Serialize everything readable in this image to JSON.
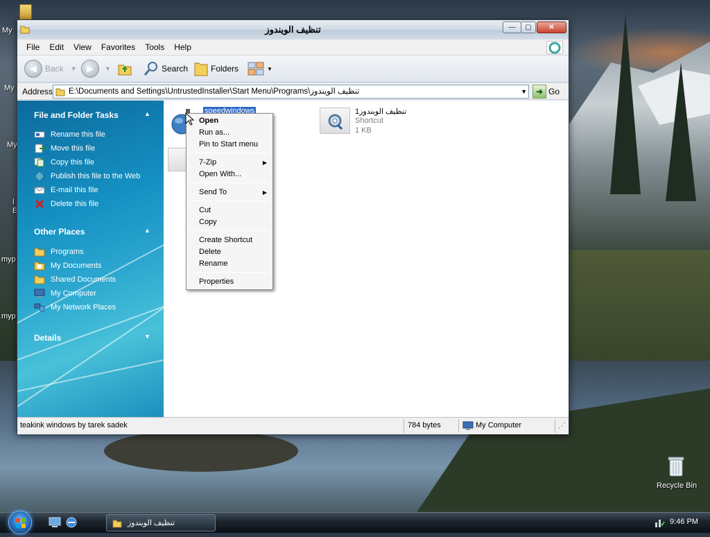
{
  "desktop": {
    "partial_labels": [
      "My",
      "My",
      "My",
      "I",
      "E",
      "myp",
      "myp"
    ],
    "recycle_bin_label": "Recycle Bin"
  },
  "window": {
    "title": "تنظيف الويندوز",
    "buttons": {
      "minimize": "—",
      "maximize": "▢",
      "close": "✕"
    }
  },
  "menubar": {
    "items": [
      "File",
      "Edit",
      "View",
      "Favorites",
      "Tools",
      "Help"
    ]
  },
  "toolbar": {
    "back_label": "Back",
    "search_label": "Search",
    "folders_label": "Folders"
  },
  "address": {
    "label": "Address",
    "value": "E:\\Documents and Settings\\UntrustedInstaller\\Start Menu\\Programs\\تنظيف الويندوز",
    "go_label": "Go"
  },
  "taskpane": {
    "file_folder_tasks": {
      "title": "File and Folder Tasks",
      "items": [
        {
          "label": "Rename this file",
          "icon": "rename-icon"
        },
        {
          "label": "Move this file",
          "icon": "move-icon"
        },
        {
          "label": "Copy this file",
          "icon": "copy-icon"
        },
        {
          "label": "Publish this file to the Web",
          "icon": "publish-icon"
        },
        {
          "label": "E-mail this file",
          "icon": "email-icon"
        },
        {
          "label": "Delete this file",
          "icon": "delete-icon"
        }
      ]
    },
    "other_places": {
      "title": "Other Places",
      "items": [
        {
          "label": "Programs",
          "icon": "folder-icon"
        },
        {
          "label": "My Documents",
          "icon": "documents-icon"
        },
        {
          "label": "Shared Documents",
          "icon": "folder-icon"
        },
        {
          "label": "My Computer",
          "icon": "computer-icon"
        },
        {
          "label": "My Network Places",
          "icon": "network-icon"
        }
      ]
    },
    "details": {
      "title": "Details"
    }
  },
  "files": [
    {
      "name": "speedwindows",
      "selected": true
    },
    {
      "name": "تنظيف الويندوز1",
      "type": "Shortcut",
      "size": "1 KB"
    }
  ],
  "context_menu": {
    "open": "Open",
    "run_as": "Run as...",
    "pin": "Pin to Start menu",
    "zip": "7-Zip",
    "open_with": "Open With...",
    "send_to": "Send To",
    "cut": "Cut",
    "copy": "Copy",
    "create_shortcut": "Create Shortcut",
    "delete": "Delete",
    "rename": "Rename",
    "properties": "Properties"
  },
  "statusbar": {
    "description": "teakink windows by tarek sadek",
    "size": "784 bytes",
    "zone": "My Computer"
  },
  "taskbar": {
    "task_label": "تنظيف الويندوز",
    "clock": "9:46 PM"
  },
  "colors": {
    "selection": "#316ac5",
    "taskpane": "#1590c2"
  }
}
